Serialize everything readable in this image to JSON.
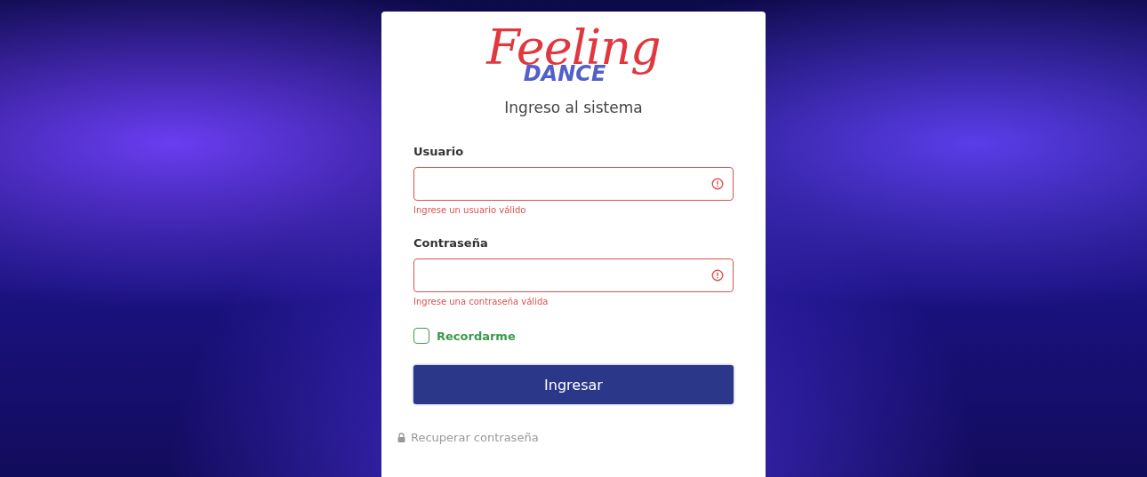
{
  "logo": {
    "script": "Feeling",
    "word": "DANCE"
  },
  "title": "Ingreso al sistema",
  "fields": [
    {
      "label": "Usuario",
      "invalid": true,
      "error": "Ingrese un usuario válido"
    },
    {
      "label": "Contraseña",
      "invalid": true,
      "error": "Ingrese una contraseña válida"
    }
  ],
  "remember": {
    "label": "Recordarme",
    "checked": false
  },
  "submit": "Ingresar",
  "recover": "Recuperar contraseña"
}
